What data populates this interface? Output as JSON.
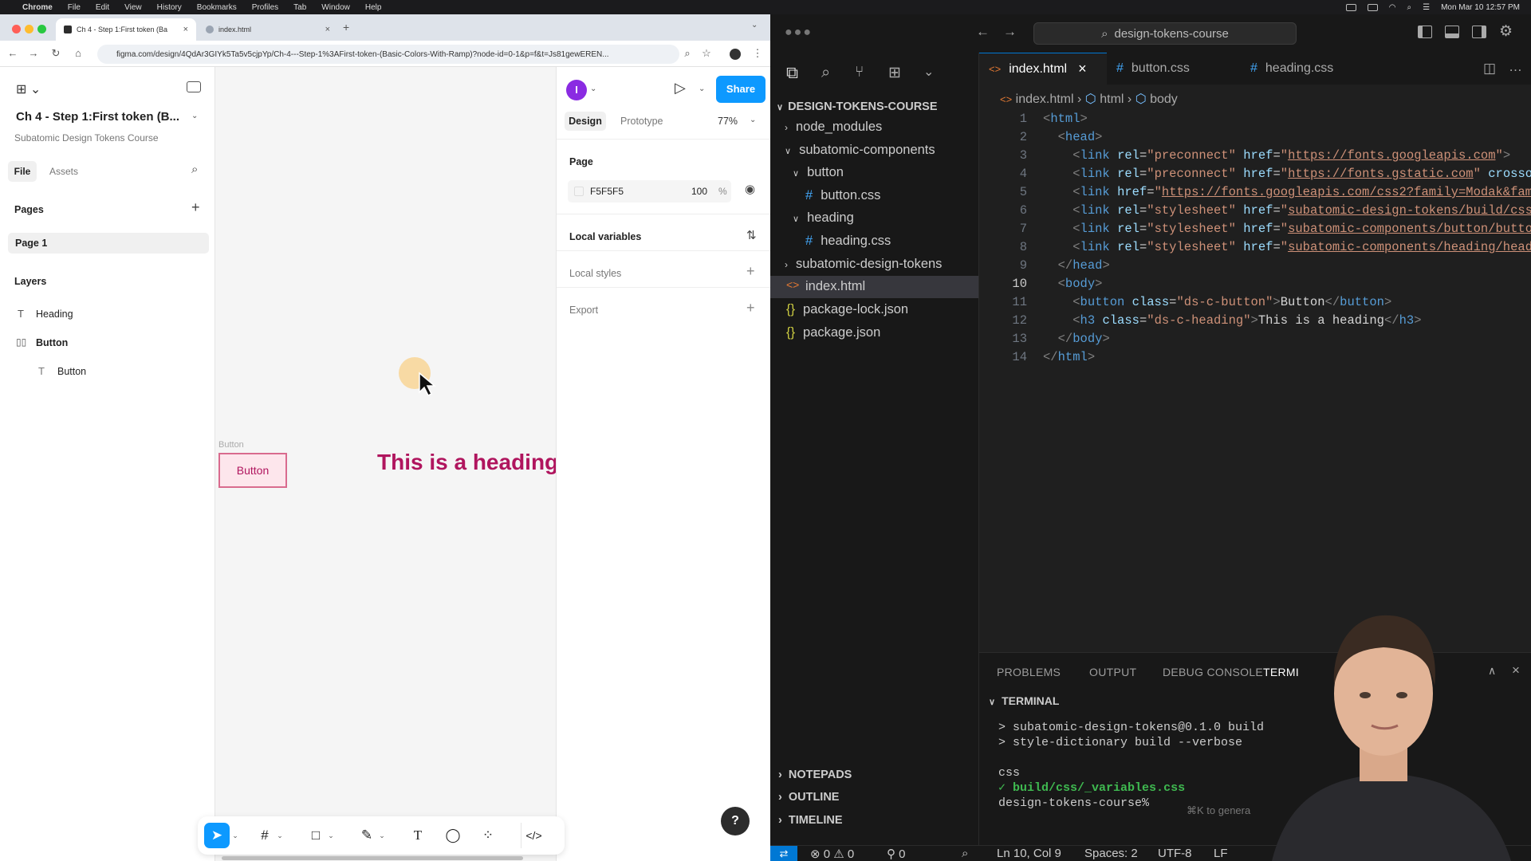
{
  "macbar": {
    "app": "Chrome",
    "menus": [
      "File",
      "Edit",
      "View",
      "History",
      "Bookmarks",
      "Profiles",
      "Tab",
      "Window",
      "Help"
    ],
    "clock": "Mon Mar 10  12:57 PM"
  },
  "browser": {
    "tabs": [
      {
        "title": "Ch 4 - Step 1:First token (Ba",
        "active": true
      },
      {
        "title": "index.html",
        "active": false
      }
    ],
    "url": "figma.com/design/4QdAr3GIYk5Ta5v5cjpYp/Ch-4---Step-1%3AFirst-token-(Basic-Colors-With-Ramp)?node-id=0-1&p=f&t=Js81gewEREN..."
  },
  "figma": {
    "file_title": "Ch 4 - Step 1:First token (B...",
    "project": "Subatomic Design Tokens Course",
    "tabs": {
      "file": "File",
      "assets": "Assets"
    },
    "pages_label": "Pages",
    "pages": [
      "Page 1"
    ],
    "layers_label": "Layers",
    "layers": [
      {
        "name": "Heading",
        "icon": "text-icon",
        "indent": 0
      },
      {
        "name": "Button",
        "icon": "autolayout-icon",
        "indent": 0
      },
      {
        "name": "Button",
        "icon": "text-icon",
        "indent": 1
      }
    ],
    "canvas": {
      "frame_label": "Button",
      "button_text": "Button",
      "heading_text": "This is a heading",
      "heading_color": "#b0155e",
      "button_border": "#d96b8e",
      "button_fill": "#fde6ec"
    },
    "right": {
      "avatar_initial": "I",
      "share": "Share",
      "design_tab": "Design",
      "prototype_tab": "Prototype",
      "zoom": "77%",
      "page_label": "Page",
      "fill_hex": "F5F5F5",
      "fill_opacity": "100",
      "percent": "%",
      "local_variables": "Local variables",
      "local_styles": "Local styles",
      "export": "Export"
    },
    "help": "?"
  },
  "vscode": {
    "search": "design-tokens-course",
    "explorer_root": "DESIGN-TOKENS-COURSE",
    "tree": [
      {
        "label": "node_modules",
        "kind": "folder",
        "open": false,
        "depth": 0
      },
      {
        "label": "subatomic-components",
        "kind": "folder",
        "open": true,
        "depth": 0
      },
      {
        "label": "button",
        "kind": "folder",
        "open": true,
        "depth": 1
      },
      {
        "label": "button.css",
        "kind": "css",
        "depth": 2
      },
      {
        "label": "heading",
        "kind": "folder",
        "open": true,
        "depth": 1
      },
      {
        "label": "heading.css",
        "kind": "css",
        "depth": 2
      },
      {
        "label": "subatomic-design-tokens",
        "kind": "folder",
        "open": false,
        "depth": 0
      },
      {
        "label": "index.html",
        "kind": "html",
        "depth": 0,
        "selected": true
      },
      {
        "label": "package-lock.json",
        "kind": "json",
        "depth": 0
      },
      {
        "label": "package.json",
        "kind": "json",
        "depth": 0
      }
    ],
    "sections": [
      "NOTEPADS",
      "OUTLINE",
      "TIMELINE"
    ],
    "editor_tabs": [
      {
        "label": "index.html",
        "kind": "html",
        "active": true
      },
      {
        "label": "button.css",
        "kind": "css",
        "active": false
      },
      {
        "label": "heading.css",
        "kind": "css",
        "active": false
      }
    ],
    "breadcrumb": [
      "index.html",
      "html",
      "body"
    ],
    "line_numbers": [
      "1",
      "2",
      "3",
      "4",
      "5",
      "6",
      "7",
      "8",
      "9",
      "10",
      "11",
      "12",
      "13",
      "14"
    ],
    "panel_tabs": [
      "PROBLEMS",
      "OUTPUT",
      "DEBUG CONSOLE",
      "TERMI"
    ],
    "terminal_label": "TERMINAL",
    "terminal_lines": [
      "> subatomic-design-tokens@0.1.0 build",
      "> style-dictionary build --verbose",
      "",
      "css",
      "✓ build/css/_variables.css",
      "design-tokens-course% "
    ],
    "terminal_hint": "⌘K to genera",
    "status": {
      "errors": "0",
      "warnings": "0",
      "ports": "0",
      "position": "Ln 10, Col 9",
      "spaces": "Spaces: 2",
      "encoding": "UTF-8",
      "eol": "LF"
    }
  }
}
